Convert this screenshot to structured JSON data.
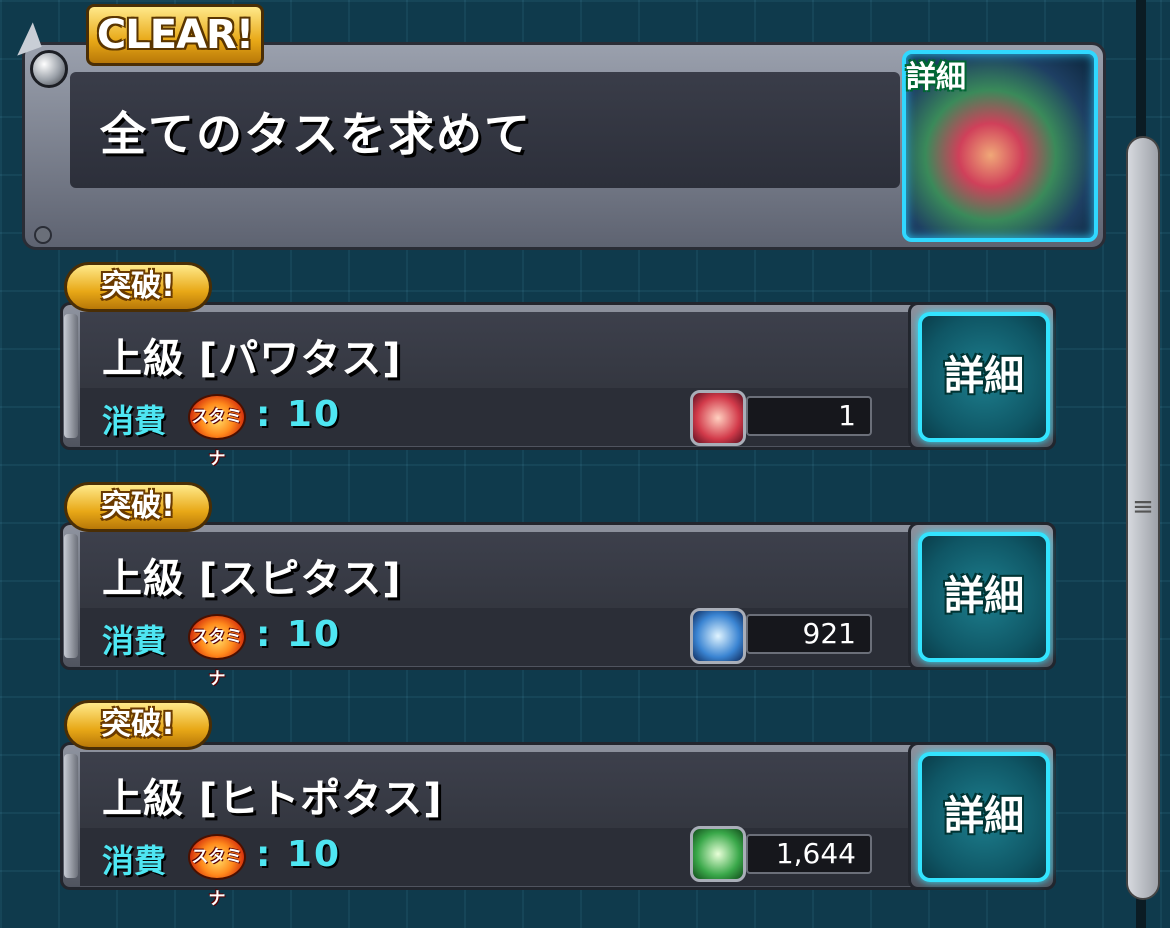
{
  "header": {
    "badge": "CLEAR!",
    "title": "全てのタスを求めて",
    "detail_label": "詳細"
  },
  "quests": [
    {
      "badge": "突破!",
      "title": "上級 [パワタス]",
      "cost_label": "消費",
      "stamina_label": "スタミナ",
      "cost_value": ": 10",
      "count": "1",
      "icon_color": "#d23a4a",
      "detail_label": "詳細"
    },
    {
      "badge": "突破!",
      "title": "上級 [スピタス]",
      "cost_label": "消費",
      "stamina_label": "スタミナ",
      "cost_value": ": 10",
      "count": "921",
      "icon_color": "#3a84d2",
      "detail_label": "詳細"
    },
    {
      "badge": "突破!",
      "title": "上級 [ヒトポタス]",
      "cost_label": "消費",
      "stamina_label": "スタミナ",
      "cost_value": ": 10",
      "count": "1,644",
      "icon_color": "#3aa84a",
      "detail_label": "詳細"
    }
  ],
  "colors": {
    "accent_cyan": "#33e4ff",
    "badge_gold": "#e8a817",
    "background": "#0f3a4c"
  }
}
